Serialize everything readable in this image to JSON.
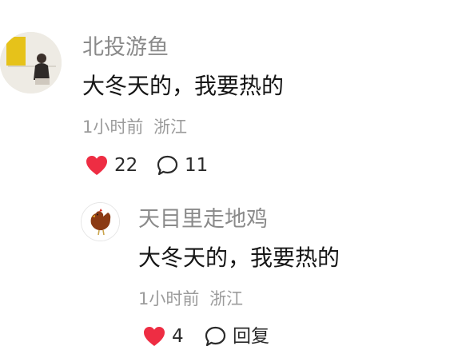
{
  "comment": {
    "username": "北投游鱼",
    "text": "大冬天的，我要热的",
    "time": "1小时前",
    "location": "浙江",
    "likes": "22",
    "replies": "11"
  },
  "reply": {
    "username": "天目里走地鸡",
    "text": "大冬天的，我要热的",
    "time": "1小时前",
    "location": "浙江",
    "likes": "4",
    "reply_label": "回复"
  },
  "colors": {
    "like_red": "#ee2d43",
    "username_gray": "#8a8a8a",
    "meta_gray": "#9c9c9c"
  },
  "icons": {
    "like": "heart-icon",
    "comment": "speech-bubble-icon"
  }
}
